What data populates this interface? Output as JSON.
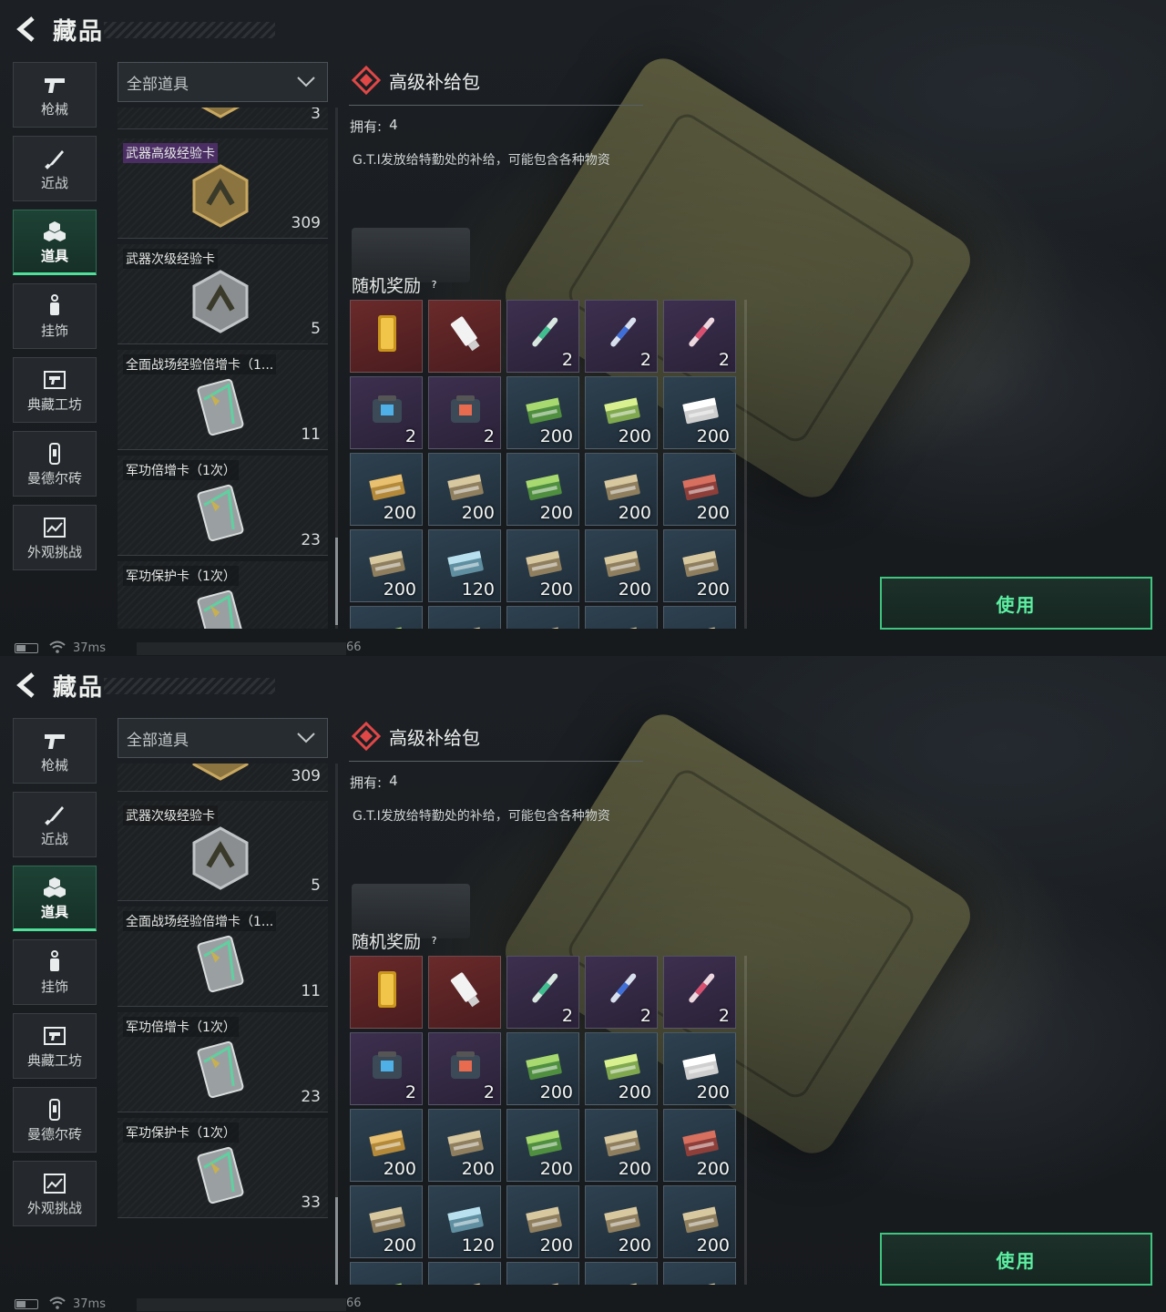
{
  "page": {
    "title": "藏品",
    "accent_color": "#4fe09a"
  },
  "nav": {
    "items": [
      {
        "label": "枪械",
        "icon": "pistol-icon"
      },
      {
        "label": "近战",
        "icon": "knife-icon"
      },
      {
        "label": "道具",
        "icon": "cubes-icon",
        "active": true
      },
      {
        "label": "挂饰",
        "icon": "charm-icon"
      },
      {
        "label": "典藏工坊",
        "icon": "workshop-icon"
      },
      {
        "label": "曼德尔砖",
        "icon": "mandel-brick-icon"
      },
      {
        "label": "外观挑战",
        "icon": "appearance-challenge-icon"
      }
    ]
  },
  "filter": {
    "selected": "全部道具"
  },
  "screens": [
    {
      "items": [
        {
          "name": "",
          "count": "3"
        },
        {
          "name": "武器高级经验卡",
          "count": "309"
        },
        {
          "name": "武器次级经验卡",
          "count": "5"
        },
        {
          "name": "全面战场经验倍增卡（1...",
          "count": "11"
        },
        {
          "name": "军功倍增卡（1次）",
          "count": "23"
        },
        {
          "name": "军功保护卡（1次）",
          "count": ""
        }
      ]
    },
    {
      "items": [
        {
          "name": "",
          "count": "309"
        },
        {
          "name": "武器次级经验卡",
          "count": "5"
        },
        {
          "name": "全面战场经验倍增卡（1...",
          "count": "11"
        },
        {
          "name": "军功倍增卡（1次）",
          "count": "23"
        },
        {
          "name": "军功保护卡（1次）",
          "count": "33"
        }
      ]
    }
  ],
  "detail": {
    "title": "高级补给包",
    "owned_label": "拥有:",
    "owned_value": "4",
    "description": "G.T.I发放给特勤处的补给，可能包含各种物资",
    "reward_title": "随机奖励",
    "help": "?"
  },
  "rewards": [
    {
      "qty": "",
      "rarity": "red",
      "icon": "gold-bar-icon"
    },
    {
      "qty": "",
      "rarity": "red",
      "icon": "usb-drive-icon"
    },
    {
      "qty": "2",
      "rarity": "purple",
      "icon": "injector-green-icon"
    },
    {
      "qty": "2",
      "rarity": "purple",
      "icon": "injector-blue-icon"
    },
    {
      "qty": "2",
      "rarity": "purple",
      "icon": "injector-red-icon"
    },
    {
      "qty": "2",
      "rarity": "purple",
      "icon": "armor-bag-blue-icon"
    },
    {
      "qty": "2",
      "rarity": "purple",
      "icon": "armor-bag-red-icon"
    },
    {
      "qty": "200",
      "rarity": "blue",
      "icon": "ammo-box-green-icon"
    },
    {
      "qty": "200",
      "rarity": "blue",
      "icon": "ammo-box-lime-icon"
    },
    {
      "qty": "200",
      "rarity": "blue",
      "icon": "ammo-box-white-icon"
    },
    {
      "qty": "200",
      "rarity": "blue",
      "icon": "ammo-box-yellow-icon"
    },
    {
      "qty": "200",
      "rarity": "blue",
      "icon": "ammo-box-tan-icon"
    },
    {
      "qty": "200",
      "rarity": "blue",
      "icon": "ammo-box-green-icon"
    },
    {
      "qty": "200",
      "rarity": "blue",
      "icon": "ammo-box-tan-icon"
    },
    {
      "qty": "200",
      "rarity": "blue",
      "icon": "ammo-box-red-icon"
    },
    {
      "qty": "200",
      "rarity": "blue",
      "icon": "ammo-box-tan-icon"
    },
    {
      "qty": "120",
      "rarity": "blue",
      "icon": "ammo-box-cyan-icon"
    },
    {
      "qty": "200",
      "rarity": "blue",
      "icon": "ammo-box-tan-icon"
    },
    {
      "qty": "200",
      "rarity": "blue",
      "icon": "ammo-box-tan-icon"
    },
    {
      "qty": "200",
      "rarity": "blue",
      "icon": "ammo-box-tan-icon"
    },
    {
      "qty": "",
      "rarity": "blue",
      "icon": "ammo-box-green-icon"
    },
    {
      "qty": "",
      "rarity": "blue",
      "icon": "ammo-box-tan-icon"
    },
    {
      "qty": "",
      "rarity": "blue",
      "icon": "ammo-box-tan-icon"
    },
    {
      "qty": "",
      "rarity": "blue",
      "icon": "ammo-box-tan-icon"
    },
    {
      "qty": "",
      "rarity": "blue",
      "icon": "ammo-box-tan-icon"
    }
  ],
  "use_button": {
    "label": "使用"
  },
  "status": {
    "ping": "37ms",
    "num": "66"
  }
}
